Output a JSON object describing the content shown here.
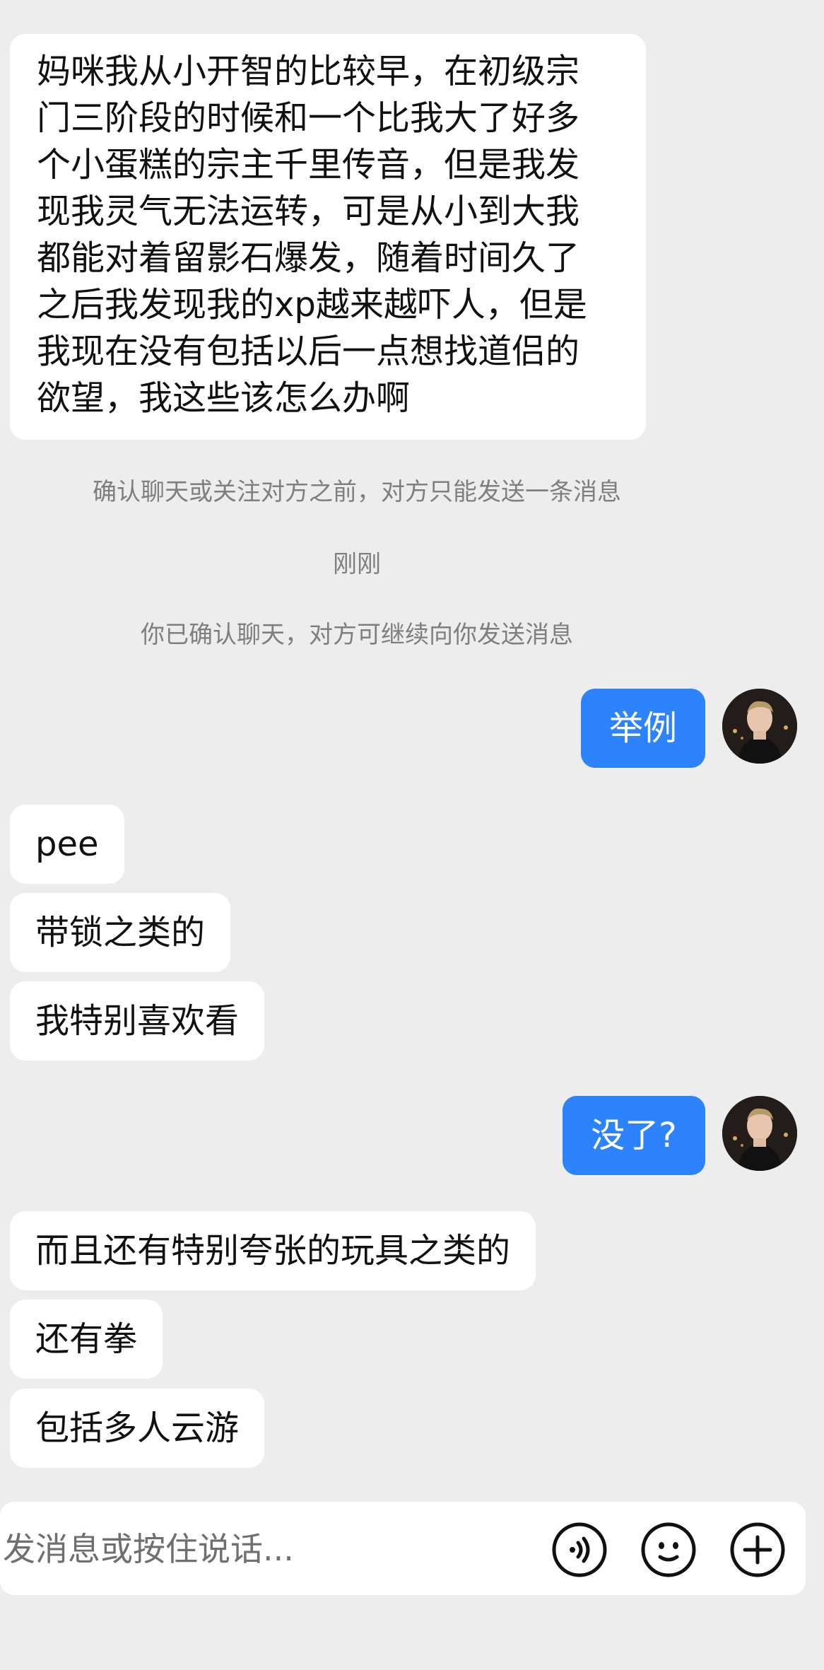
{
  "messages": {
    "incoming_long_lines": [
      "妈咪我从小开智的比较早，在初级宗",
      "门三阶段的时候和一个比我大了好多",
      "个小蛋糕的宗主千里传音，但是我发",
      "现我灵气无法运转，可是从小到大我",
      "都能对着留影石爆发，随着时间久了",
      "之后我发现我的xp越来越吓人，但是",
      "我现在没有包括以后一点想找道侣的",
      "欲望，我这些该怎么办啊"
    ],
    "system_notice_1": "确认聊天或关注对方之前，对方只能发送一条消息",
    "timestamp": "刚刚",
    "system_notice_2": "你已确认聊天，对方可继续向你发送消息",
    "outgoing_1": "举例",
    "incoming_1": "pee",
    "incoming_2": "带锁之类的",
    "incoming_3": "我特别喜欢看",
    "outgoing_2": "没了?",
    "incoming_4": "而且还有特别夸张的玩具之类的",
    "incoming_5": "还有拳",
    "incoming_6": "包括多人云游"
  },
  "input_bar": {
    "placeholder": "发消息或按住说话...",
    "icons": [
      "voice-icon",
      "emoji-icon",
      "plus-icon"
    ]
  },
  "colors": {
    "background": "#ededed",
    "incoming_bubble": "#ffffff",
    "outgoing_bubble": "#2d83fb",
    "system_text": "#7f7f7f"
  }
}
